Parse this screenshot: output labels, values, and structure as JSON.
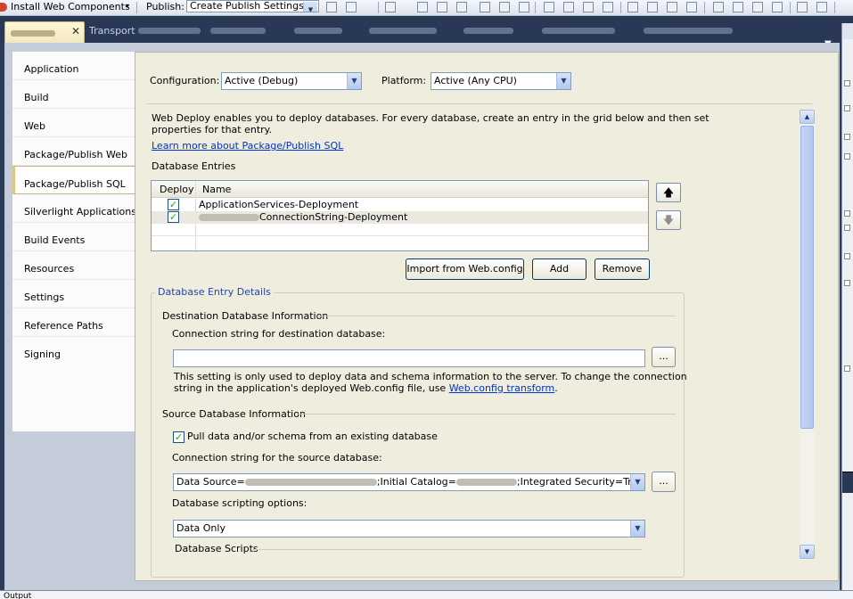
{
  "toolbar": {
    "install_web_components": "Install Web Components",
    "publish_label": "Publish:",
    "publish_combo": "Create Publish Settings"
  },
  "tabs": {
    "items": [
      {
        "label": "Transport"
      },
      {
        "label": ""
      },
      {
        "label": ""
      },
      {
        "label": ""
      },
      {
        "label": ""
      },
      {
        "label": ""
      }
    ]
  },
  "nav": {
    "items": [
      {
        "label": "Application"
      },
      {
        "label": "Build"
      },
      {
        "label": "Web"
      },
      {
        "label": "Package/Publish Web"
      },
      {
        "label": "Package/Publish SQL"
      },
      {
        "label": "Silverlight Applications"
      },
      {
        "label": "Build Events"
      },
      {
        "label": "Resources"
      },
      {
        "label": "Settings"
      },
      {
        "label": "Reference Paths"
      },
      {
        "label": "Signing"
      }
    ],
    "active": "Package/Publish SQL"
  },
  "config": {
    "configuration_label": "Configuration:",
    "configuration_value": "Active (Debug)",
    "platform_label": "Platform:",
    "platform_value": "Active (Any CPU)"
  },
  "intro": {
    "text_line1": "Web Deploy enables you to deploy databases. For every database, create an entry in the grid below and then set",
    "text_line2": "properties for that entry.",
    "learn_more": "Learn more about Package/Publish SQL"
  },
  "entries": {
    "title": "Database Entries",
    "col_deploy": "Deploy",
    "col_name": "Name",
    "rows": [
      {
        "deploy": true,
        "name": "ApplicationServices-Deployment"
      },
      {
        "deploy": true,
        "name": "ConnectionString-Deployment"
      }
    ],
    "import_button": "Import from Web.config",
    "add_button": "Add",
    "remove_button": "Remove"
  },
  "details": {
    "title": "Database Entry Details",
    "destination_section": "Destination Database Information",
    "dest_conn_label": "Connection string for destination database:",
    "dest_conn_value": "",
    "browse_label": "...",
    "dest_note_line1": "This setting is only used to deploy data and schema information to the server. To change the connection",
    "dest_note_line2_prefix": "string in the application's deployed Web.config file, use ",
    "dest_note_link": "Web.config transform",
    "dest_note_suffix": ".",
    "source_section": "Source Database Information",
    "pull_checkbox": "Pull data and/or schema from an existing database",
    "pull_checked": true,
    "source_conn_label": "Connection string for the source database:",
    "source_conn_part1": "Data Source=",
    "source_conn_part2": ";Initial Catalog=",
    "source_conn_part3": ";Integrated Security=True",
    "scripting_label": "Database scripting options:",
    "scripting_value": "Data Only",
    "scripts_section": "Database Scripts"
  },
  "output": {
    "title": "Output"
  }
}
